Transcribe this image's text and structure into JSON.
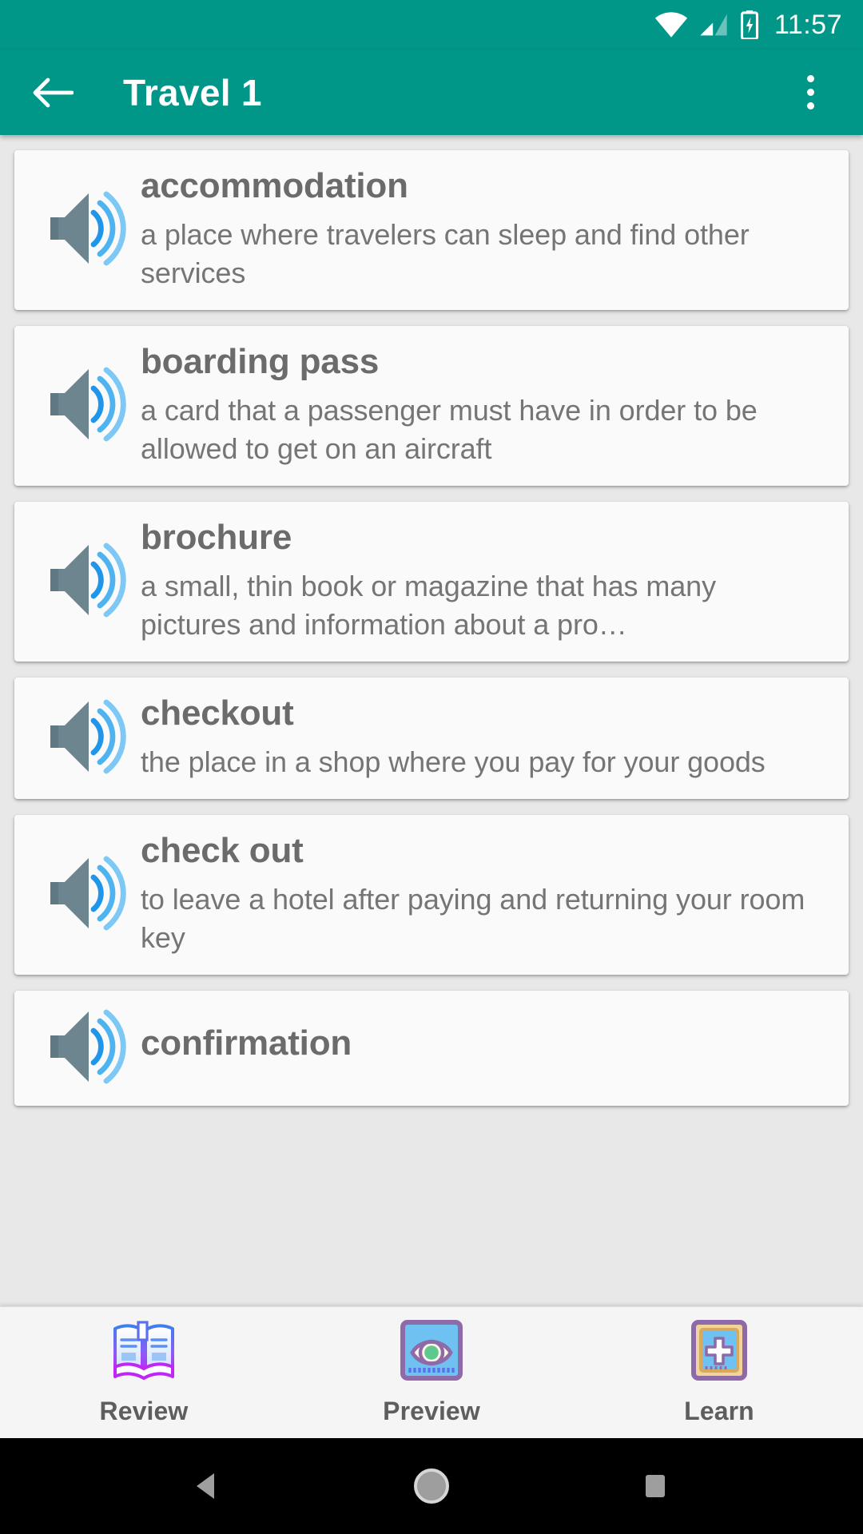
{
  "statusbar": {
    "time": "11:57",
    "icons": [
      "wifi-icon",
      "cellular-signal-icon",
      "battery-charging-icon"
    ]
  },
  "appbar": {
    "title": "Travel 1",
    "back_icon": "back-arrow-icon",
    "overflow_icon": "overflow-menu-icon",
    "background_color": "#009688"
  },
  "list": {
    "speaker_icon": "speaker-audio-icon",
    "items": [
      {
        "term": "accommodation",
        "definition": "a place where travelers can sleep and find other services"
      },
      {
        "term": "boarding pass",
        "definition": "a card that a passenger must have in order to be allowed to get on an aircraft"
      },
      {
        "term": "brochure",
        "definition": "a small, thin book or magazine that has many pictures and information about a pro…"
      },
      {
        "term": "checkout",
        "definition": "the place in a shop where you pay for your goods"
      },
      {
        "term": "check out",
        "definition": "to leave a hotel after paying and returning your room key"
      },
      {
        "term": "confirmation",
        "definition": ""
      }
    ]
  },
  "bottomnav": {
    "items": [
      {
        "label": "Review",
        "icon": "open-book-icon"
      },
      {
        "label": "Preview",
        "icon": "eye-card-icon"
      },
      {
        "label": "Learn",
        "icon": "plus-card-icon"
      }
    ]
  },
  "sysnav": {
    "back": "system-back-icon",
    "home": "system-home-icon",
    "recents": "system-recents-icon"
  },
  "colors": {
    "accent": "#009688",
    "card_bg": "#fafafa",
    "list_bg": "#e8e8e8",
    "text_primary": "#6b6b6b",
    "text_secondary": "#757575",
    "speaker_body": "#5f7984",
    "speaker_wave": "#29a8e8"
  }
}
